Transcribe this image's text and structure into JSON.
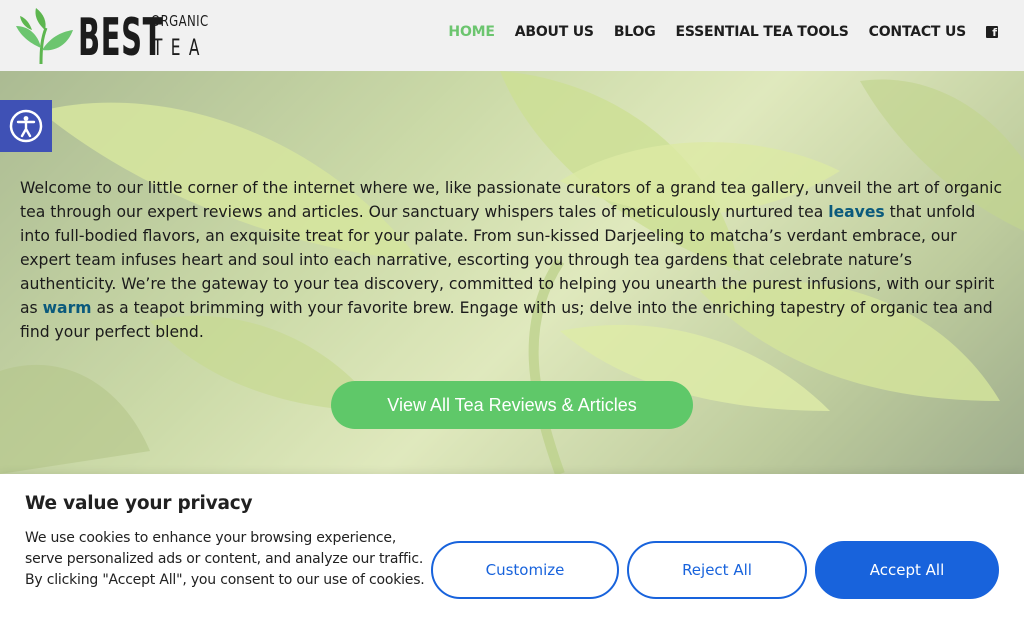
{
  "header": {
    "logo": {
      "best": "BEST",
      "organic": "ORGANIC",
      "tea": "TEA"
    },
    "nav": [
      {
        "label": "HOME",
        "active": true
      },
      {
        "label": "ABOUT US",
        "active": false
      },
      {
        "label": "BLOG",
        "active": false
      },
      {
        "label": "ESSENTIAL TEA TOOLS",
        "active": false
      },
      {
        "label": "CONTACT US",
        "active": false
      }
    ],
    "social_icon": "facebook-icon",
    "social_glyph": "f"
  },
  "accessibility": {
    "icon": "accessibility-icon"
  },
  "hero": {
    "paragraph_1": "Welcome to our little corner of the internet where we, like passionate curators of a grand tea gallery, unveil the art of organic tea through our expert reviews and articles. Our sanctuary whispers tales of meticulously nurtured tea ",
    "link_1": "leaves",
    "paragraph_2": " that unfold into full-bodied flavors, an exquisite treat for your palate. From sun-kissed Darjeeling to matcha’s verdant embrace, our expert team infuses heart and soul into each narrative, escorting you through tea gardens that celebrate nature’s authenticity. We’re the gateway to your tea discovery, committed to helping you unearth the purest infusions, with our spirit as ",
    "link_2": "warm",
    "paragraph_3": " as a teapot brimming with your favorite brew. Engage with us; delve into the enriching tapestry of organic tea and find your perfect blend.",
    "cta_label": "View All Tea Reviews & Articles"
  },
  "cookie": {
    "title": "We value your privacy",
    "body": "We use cookies to enhance your browsing experience, serve personalized ads or content, and analyze our traffic. By clicking \"Accept All\", you consent to our use of cookies.",
    "customize_label": "Customize",
    "reject_label": "Reject All",
    "accept_label": "Accept All"
  },
  "colors": {
    "accent_green": "#6cc56f",
    "cta_green": "#5fc869",
    "cookie_blue": "#1863dc",
    "link_blue": "#0b5a7c",
    "accessibility_blue": "#3f51b5"
  }
}
